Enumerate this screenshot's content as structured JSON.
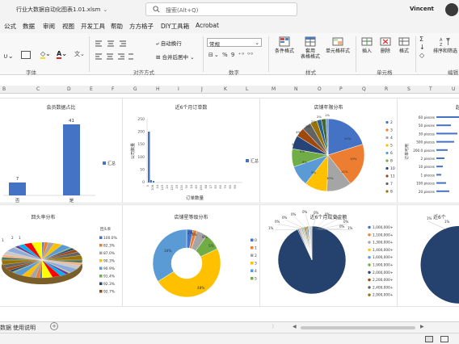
{
  "titlebar": {
    "filename": "行业大数据自动化图表1.01.xlsm",
    "search_placeholder": "搜索(Alt+Q)",
    "user": "Vincent"
  },
  "menu": [
    "公式",
    "数据",
    "审阅",
    "视图",
    "开发工具",
    "帮助",
    "方方格子",
    "DIY工具箱",
    "Acrobat"
  ],
  "ribbon": {
    "groups": [
      "字体",
      "对齐方式",
      "数字",
      "样式",
      "单元格",
      "编辑"
    ],
    "wrap_text": "自动换行",
    "merge_center": "合并后居中",
    "number_format": "常规",
    "cond_format": "条件格式",
    "table_format": "套用\n表格格式",
    "cell_style": "单元格样式",
    "insert": "插入",
    "delete": "删除",
    "format": "格式",
    "sort_filter": "排序和筛选"
  },
  "columns": [
    "B",
    "C",
    "D",
    "E",
    "F",
    "G",
    "H",
    "I",
    "J",
    "K",
    "L",
    "M",
    "N",
    "O",
    "P",
    "Q",
    "R",
    "S",
    "T",
    "U"
  ],
  "sheet_tabs": [
    "数据",
    "使用说明"
  ],
  "charts": {
    "member_ratio": {
      "title": "会员数据占比",
      "chart_data": {
        "type": "bar",
        "categories": [
          "否",
          "是"
        ],
        "values": [
          7,
          41
        ],
        "legend": "汇总"
      }
    },
    "orders6m": {
      "title": "近6个月订单数",
      "chart_data": {
        "type": "bar",
        "xlabel": "订单数量",
        "ylabel": "公司数量",
        "legend": "汇总",
        "y_ticks": [
          "0",
          "50",
          "100",
          "150",
          "200",
          "250"
        ],
        "x_ticks": [
          "0",
          "108",
          "14",
          "115",
          "20",
          "120",
          "25",
          "130",
          "30",
          "14",
          "40",
          "150",
          "48",
          "17",
          "50",
          "60",
          "70",
          "80",
          "89"
        ]
      }
    },
    "store_age": {
      "title": "店铺年限分布",
      "chart_data": {
        "type": "pie",
        "legend": [
          "2",
          "3",
          "4",
          "5",
          "6",
          "8",
          "10",
          "11",
          "7",
          "8"
        ],
        "labels": [
          "20%",
          "19%",
          "11%",
          "10%",
          "9%",
          "8%",
          "6%",
          "4%",
          "4%",
          "3%",
          "2%",
          "2%",
          "1%"
        ]
      }
    },
    "sales_dist": {
      "title": "起",
      "chart_data": {
        "type": "bar",
        "ylabel": "订单可用",
        "categories": [
          "60 pieces",
          "50 pieces",
          "30 pieces",
          "500 pieces",
          "200.0 pieces",
          "2 pieces",
          "10 pieces",
          "1 pieces",
          "100 pieces",
          "20 pieces"
        ]
      }
    },
    "repurchase": {
      "title": "回头率分布",
      "chart_data": {
        "type": "pie",
        "legend_title": "回头率",
        "legend": [
          "100.0%",
          "82.3%",
          "87.0%",
          "90.3%",
          "90.9%",
          "91.4%",
          "92.3%",
          "92.7%"
        ],
        "labels": [
          "2",
          "1",
          "1"
        ]
      }
    },
    "store_level": {
      "title": "店铺星等级分布",
      "chart_data": {
        "type": "pie",
        "legend": [
          "0",
          "1",
          "2",
          "3",
          "4",
          "5"
        ],
        "labels": [
          "48%",
          "34%",
          "8%",
          "5%",
          "3%",
          "2%"
        ]
      }
    },
    "txn6m": {
      "title": "近6个月成交金额",
      "chart_data": {
        "type": "pie",
        "legend": [
          "1,000,000+",
          "1,100,000+",
          "1,300,000+",
          "1,400,000+",
          "1,600,000+",
          "1,900,000+",
          "2,000,000+",
          "2,200,000+",
          "2,400,000+",
          "2,900,000+"
        ],
        "labels": [
          "1%",
          "0%",
          "0%",
          "0%",
          "0%",
          "0%",
          "0%",
          "0%",
          "0%",
          "1%",
          "0%"
        ]
      }
    },
    "partial": {
      "title": "近6个",
      "chart_data": {
        "type": "pie",
        "labels": [
          "1%",
          "1%"
        ]
      }
    }
  }
}
